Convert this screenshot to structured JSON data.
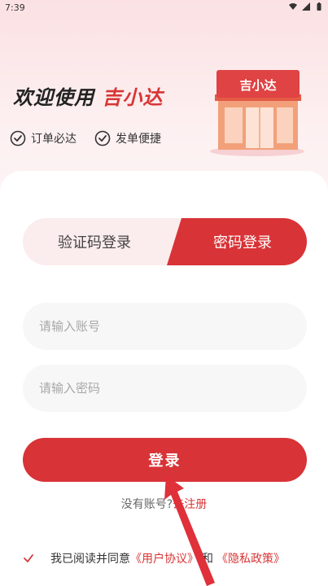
{
  "status_bar": {
    "time": "7:39"
  },
  "hero": {
    "title_prefix": "欢迎使用",
    "brand": "吉小达",
    "features": [
      "订单必达",
      "发单便捷"
    ],
    "store_sign": "吉小达"
  },
  "tabs": {
    "sms": "验证码登录",
    "password": "密码登录",
    "active": "password"
  },
  "form": {
    "account_placeholder": "请输入账号",
    "password_placeholder": "请输入密码",
    "login_button": "登录"
  },
  "register": {
    "prefix": "没有账号?",
    "link": "去注册"
  },
  "agreement": {
    "text": "我已阅读并同意",
    "user_link": "《用户协议》",
    "and": "和",
    "privacy_link": "《隐私政策》",
    "checked": true
  },
  "colors": {
    "accent": "#d83337",
    "tab_inactive_bg": "#fbeced",
    "field_bg": "#f7f7f7"
  }
}
